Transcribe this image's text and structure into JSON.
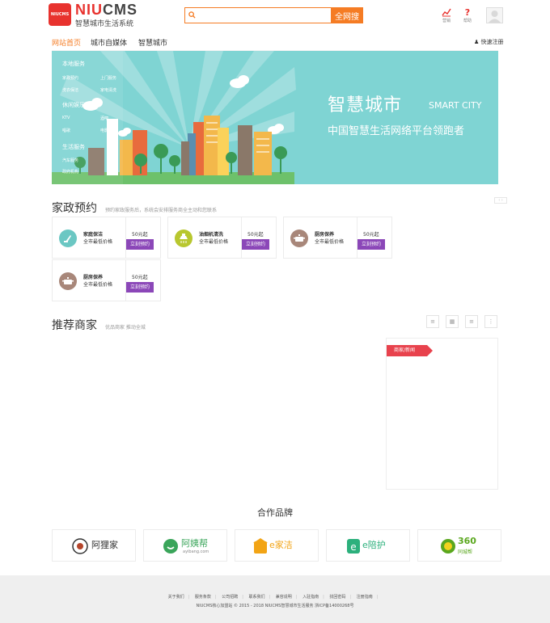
{
  "header": {
    "logo_badge": "NIUCMS",
    "logo_word_a": "NIU",
    "logo_word_b": "CMS",
    "logo_subtitle": "智慧城市生活系统",
    "search_placeholder": "",
    "search_button": "全网搜",
    "tools": [
      {
        "label": "营销",
        "icon": "chart-icon"
      },
      {
        "label": "帮助",
        "icon": "question-icon"
      }
    ]
  },
  "nav": {
    "items": [
      "网站首页",
      "城市自媒体",
      "智慧城市"
    ],
    "quick_register": "快速注册"
  },
  "banner": {
    "menu": [
      {
        "heading": "本地服务",
        "items": [
          "家政预约",
          "上门服务",
          "洗衣保洁",
          "家电清洗"
        ]
      },
      {
        "heading": "休闲娱乐",
        "items": [
          "KTV",
          "酒吧",
          "唱歌",
          "电影"
        ]
      },
      {
        "heading": "生活服务",
        "items": [
          "汽车服务",
          "政府机构"
        ]
      }
    ],
    "title": "智慧城市",
    "title_en": "SMART CITY",
    "slogan": "中国智慧生活网络平台领跑者"
  },
  "pager": "‹ ›",
  "housekeeping": {
    "title": "家政预约",
    "subtitle": "预约家政服务后，系统会安排服务商全主动和您联系",
    "cards": [
      {
        "name": "家庭保洁",
        "desc": "全市最低价格",
        "price": "50元起",
        "button": "立刻预约",
        "color": "#6bc7c3",
        "icon": "broom-icon"
      },
      {
        "name": "油烟机清洗",
        "desc": "全市最低价格",
        "price": "50元起",
        "button": "立刻预约",
        "color": "#b8c72f",
        "icon": "range-hood-icon"
      },
      {
        "name": "厨房保养",
        "desc": "全市最低价格",
        "price": "50元起",
        "button": "立刻预约",
        "color": "#a8877a",
        "icon": "pot-icon"
      },
      {
        "name": "厨房保养",
        "desc": "全市最低价格",
        "price": "50元起",
        "button": "立刻预约",
        "color": "#a8877a",
        "icon": "pot-icon"
      }
    ]
  },
  "merchants": {
    "title": "推荐商家",
    "subtitle": "优品商家 推动全城",
    "view_buttons": [
      "list-icon",
      "grid-icon",
      "category-icon",
      "more-icon"
    ],
    "panel_tag": "商家/新闻"
  },
  "partners": {
    "title": "合作品牌",
    "brands": [
      {
        "name": "阿狸家",
        "color": "#333333"
      },
      {
        "name": "阿姨帮",
        "sub": "ayibang.com",
        "color": "#3aa55a"
      },
      {
        "name": "e家洁",
        "color": "#f2a415"
      },
      {
        "name": "e陪护",
        "color": "#2cb07c"
      },
      {
        "name": "360",
        "sub": "同城帮",
        "color": "#5aa71e"
      }
    ]
  },
  "footer": {
    "links": [
      "关于我们",
      "服务条款",
      "公司招聘",
      "联系我们",
      "兼容说明",
      "入驻指南",
      "找回密码",
      "注册指南"
    ],
    "copyright": "NIUCMS核心加盟站  © 2015 - 2018  NIUCMS智慧城市生活服务  浙ICP备14000268号"
  }
}
